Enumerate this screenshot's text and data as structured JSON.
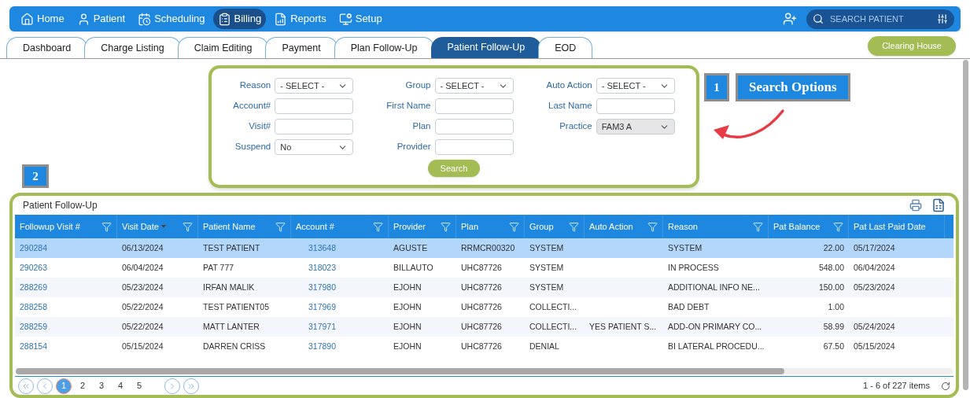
{
  "nav": {
    "items": [
      {
        "label": "Home",
        "selected": false
      },
      {
        "label": "Patient",
        "selected": false
      },
      {
        "label": "Scheduling",
        "selected": false
      },
      {
        "label": "Billing",
        "selected": true
      },
      {
        "label": "Reports",
        "selected": false
      },
      {
        "label": "Setup",
        "selected": false
      }
    ],
    "search": {
      "placeholder": "SEARCH PATIENT"
    }
  },
  "tabs": [
    {
      "label": "Dashboard",
      "selected": false
    },
    {
      "label": "Charge Listing",
      "selected": false
    },
    {
      "label": "Claim Editing",
      "selected": false
    },
    {
      "label": "Payment",
      "selected": false
    },
    {
      "label": "Plan Follow-Up",
      "selected": false
    },
    {
      "label": "Patient Follow-Up",
      "selected": true
    },
    {
      "label": "EOD",
      "selected": false
    }
  ],
  "clearing_house_button": "Clearing House",
  "search_options": {
    "columns": [
      [
        {
          "label": "Reason",
          "kind": "select",
          "value": "- SELECT -",
          "disabled": false
        },
        {
          "label": "Account#",
          "kind": "input",
          "disabled": false
        },
        {
          "label": "Visit#",
          "kind": "input",
          "disabled": false
        },
        {
          "label": "Suspend",
          "kind": "select",
          "value": "No",
          "disabled": false
        }
      ],
      [
        {
          "label": "Group",
          "kind": "select",
          "value": "- SELECT -",
          "disabled": false
        },
        {
          "label": "First Name",
          "kind": "input",
          "disabled": false
        },
        {
          "label": "Plan",
          "kind": "input",
          "disabled": false
        },
        {
          "label": "Provider",
          "kind": "input",
          "disabled": false
        }
      ],
      [
        {
          "label": "Auto Action",
          "kind": "select",
          "value": "- SELECT -",
          "disabled": false
        },
        {
          "label": "Last Name",
          "kind": "input",
          "disabled": false
        },
        {
          "label": "Practice",
          "kind": "select",
          "value": "FAM3 A",
          "disabled": true
        }
      ]
    ],
    "search_button": "Search"
  },
  "annotations": {
    "search_marker": "1",
    "search_label": "Search Options",
    "grid_marker": "2"
  },
  "grid": {
    "title": "Patient Follow-Up",
    "columns": [
      {
        "label": "Followup Visit #",
        "kind": "link",
        "filter": true,
        "sorted": false
      },
      {
        "label": "Visit Date",
        "kind": "text",
        "filter": true,
        "sorted": true
      },
      {
        "label": "Patient Name",
        "kind": "text",
        "filter": true,
        "sorted": false
      },
      {
        "label": "Account #",
        "kind": "link",
        "filter": true,
        "sorted": false
      },
      {
        "label": "Provider",
        "kind": "text",
        "filter": true,
        "sorted": false
      },
      {
        "label": "Plan",
        "kind": "text",
        "filter": true,
        "sorted": false
      },
      {
        "label": "Group",
        "kind": "text",
        "filter": true,
        "sorted": false
      },
      {
        "label": "Auto Action",
        "kind": "text",
        "filter": true,
        "sorted": false
      },
      {
        "label": "Reason",
        "kind": "text",
        "filter": true,
        "sorted": false
      },
      {
        "label": "Pat Balance",
        "kind": "number",
        "filter": true,
        "sorted": false
      },
      {
        "label": "Pat Last Paid Date",
        "kind": "text",
        "filter": false,
        "sorted": false
      }
    ],
    "rows": [
      {
        "selected": true,
        "cells": [
          "290284",
          "06/13/2024",
          "TEST PATIENT",
          "313648",
          "AGUSTE",
          "RRMCR00320",
          "SYSTEM",
          "",
          "SYSTEM",
          "22.00",
          "05/17/2024"
        ]
      },
      {
        "selected": false,
        "cells": [
          "290263",
          "06/04/2024",
          "PAT 777",
          "318023",
          "BILLAUTO",
          "UHC87726",
          "SYSTEM",
          "",
          "IN PROCESS",
          "548.00",
          "06/04/2024"
        ]
      },
      {
        "selected": false,
        "cells": [
          "288269",
          "05/23/2024",
          "IRFAN MALIK",
          "317980",
          "EJOHN",
          "UHC87726",
          "SYSTEM",
          "",
          "ADDITIONAL INFO NE...",
          "150.00",
          "05/23/2024"
        ]
      },
      {
        "selected": false,
        "cells": [
          "288258",
          "05/22/2024",
          "TEST PATIENT05",
          "317969",
          "EJOHN",
          "UHC87726",
          "COLLECTI...",
          "",
          "BAD DEBT",
          "1.00",
          ""
        ]
      },
      {
        "selected": false,
        "cells": [
          "288259",
          "05/22/2024",
          "MATT LANTER",
          "317971",
          "EJOHN",
          "UHC87726",
          "COLLECTI...",
          "YES PATIENT S...",
          "ADD-ON PRIMARY CO...",
          "58.99",
          "05/24/2024"
        ]
      },
      {
        "selected": false,
        "cells": [
          "288154",
          "05/15/2024",
          "DARREN CRISS",
          "317890",
          "EJOHN",
          "UHC87726",
          "DENIAL",
          "",
          "BI LATERAL PROCEDU...",
          "67.50",
          "05/15/2024"
        ]
      }
    ],
    "pager": {
      "pages": [
        {
          "label": "1",
          "selected": true
        },
        {
          "label": "2",
          "selected": false
        },
        {
          "label": "3",
          "selected": false
        },
        {
          "label": "4",
          "selected": false
        },
        {
          "label": "5",
          "selected": false
        }
      ],
      "summary": "1 - 6 of 227 items"
    }
  }
}
